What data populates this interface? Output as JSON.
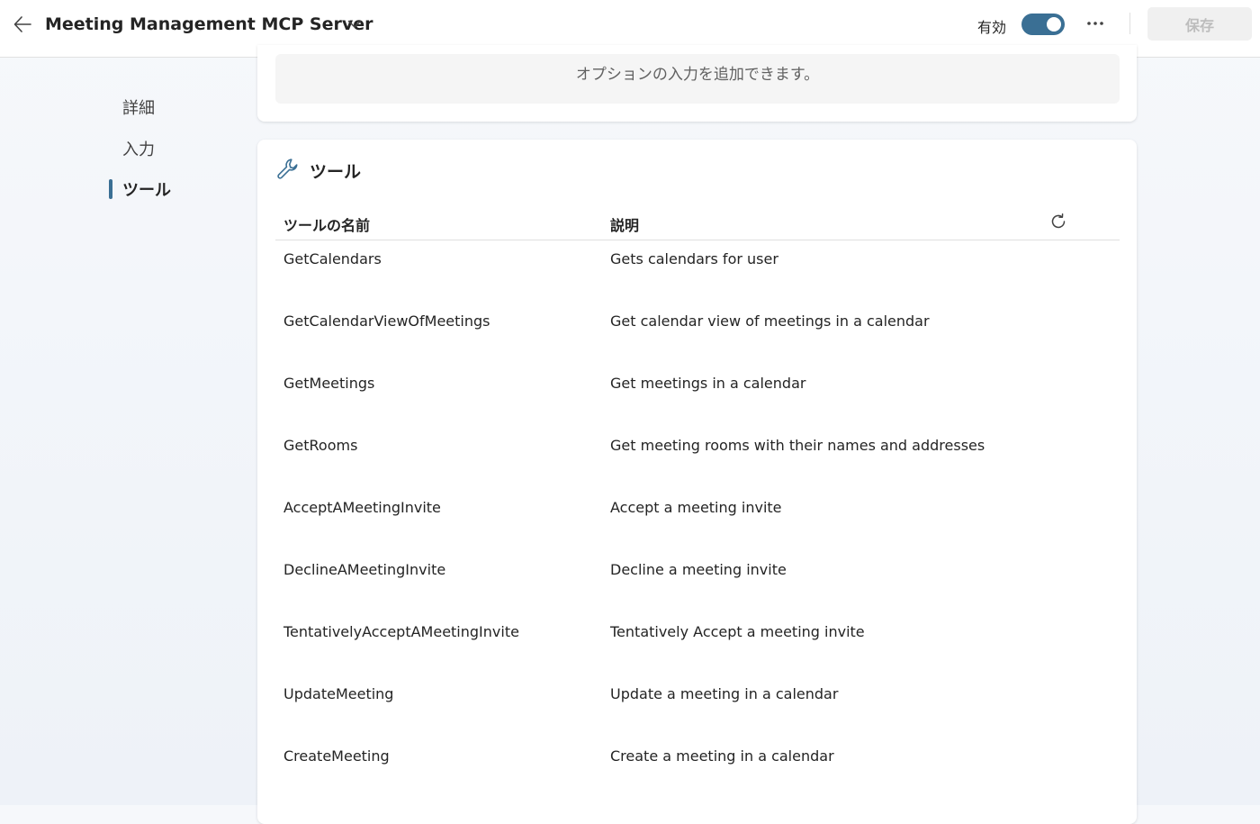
{
  "header": {
    "title": "Meeting Management MCP Server",
    "toggle_label": "有効",
    "toggle_on": true,
    "save_label": "保存"
  },
  "nav": {
    "items": [
      {
        "label": "詳細",
        "active": false
      },
      {
        "label": "入力",
        "active": false
      },
      {
        "label": "ツール",
        "active": true
      }
    ]
  },
  "inputs_section": {
    "note": "オプションの入力を追加できます。"
  },
  "tools_section": {
    "title": "ツール",
    "columns": {
      "name": "ツールの名前",
      "description": "説明"
    },
    "rows": [
      {
        "name": "GetCalendars",
        "description": "Gets calendars for user"
      },
      {
        "name": "GetCalendarViewOfMeetings",
        "description": "Get calendar view of meetings in a calendar"
      },
      {
        "name": "GetMeetings",
        "description": "Get meetings in a calendar"
      },
      {
        "name": "GetRooms",
        "description": "Get meeting rooms with their names and addresses"
      },
      {
        "name": "AcceptAMeetingInvite",
        "description": "Accept a meeting invite"
      },
      {
        "name": "DeclineAMeetingInvite",
        "description": "Decline a meeting invite"
      },
      {
        "name": "TentativelyAcceptAMeetingInvite",
        "description": "Tentatively Accept a meeting invite"
      },
      {
        "name": "UpdateMeeting",
        "description": "Update a meeting in a calendar"
      },
      {
        "name": "CreateMeeting",
        "description": "Create a meeting in a calendar"
      }
    ]
  },
  "icons": {
    "back": "arrow-left-icon",
    "title_menu": "chevron-down-icon",
    "more": "more-horizontal-icon",
    "tools": "wrench-icon",
    "refresh": "refresh-icon"
  },
  "colors": {
    "accent": "#3a6f94"
  }
}
